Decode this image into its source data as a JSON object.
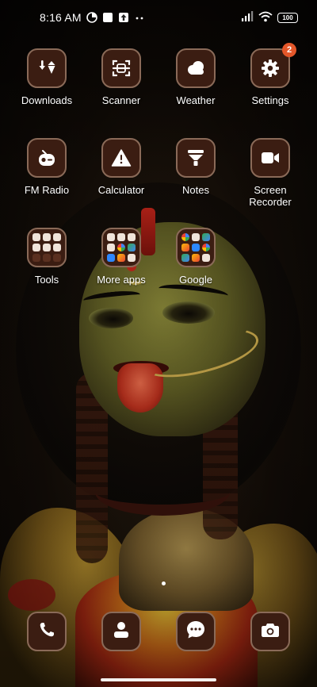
{
  "status_bar": {
    "time": "8:16 AM",
    "battery": "100",
    "notification_icons": [
      "data-saver-icon",
      "app-notification-icon",
      "upload-icon",
      "more-dots-icon"
    ],
    "system_icons": [
      "signal-icon",
      "wifi-icon",
      "battery-icon"
    ]
  },
  "apps": [
    {
      "label": "Downloads",
      "icon": "download-icon"
    },
    {
      "label": "Scanner",
      "icon": "scanner-icon"
    },
    {
      "label": "Weather",
      "icon": "cloud-icon"
    },
    {
      "label": "Settings",
      "icon": "gear-icon",
      "badge": "2"
    },
    {
      "label": "FM Radio",
      "icon": "radio-icon"
    },
    {
      "label": "Calculator",
      "icon": "warning-triangle-icon"
    },
    {
      "label": "Notes",
      "icon": "notes-funnel-icon"
    },
    {
      "label": "Screen\nRecorder",
      "line1": "Screen",
      "line2": "Recorder",
      "icon": "video-camera-icon"
    }
  ],
  "folders": [
    {
      "label": "Tools"
    },
    {
      "label": "More apps"
    },
    {
      "label": "Google"
    }
  ],
  "dock": [
    {
      "name": "phone",
      "icon": "phone-icon"
    },
    {
      "name": "contacts",
      "icon": "person-icon"
    },
    {
      "name": "messages",
      "icon": "chat-bubble-icon"
    },
    {
      "name": "camera",
      "icon": "camera-icon"
    }
  ],
  "page_indicator": {
    "pages": 1,
    "current": 1
  },
  "colors": {
    "icon_background": "#3b1d12",
    "icon_border": "#8a6a58",
    "badge": "#e4572a",
    "text": "#ffffff"
  }
}
